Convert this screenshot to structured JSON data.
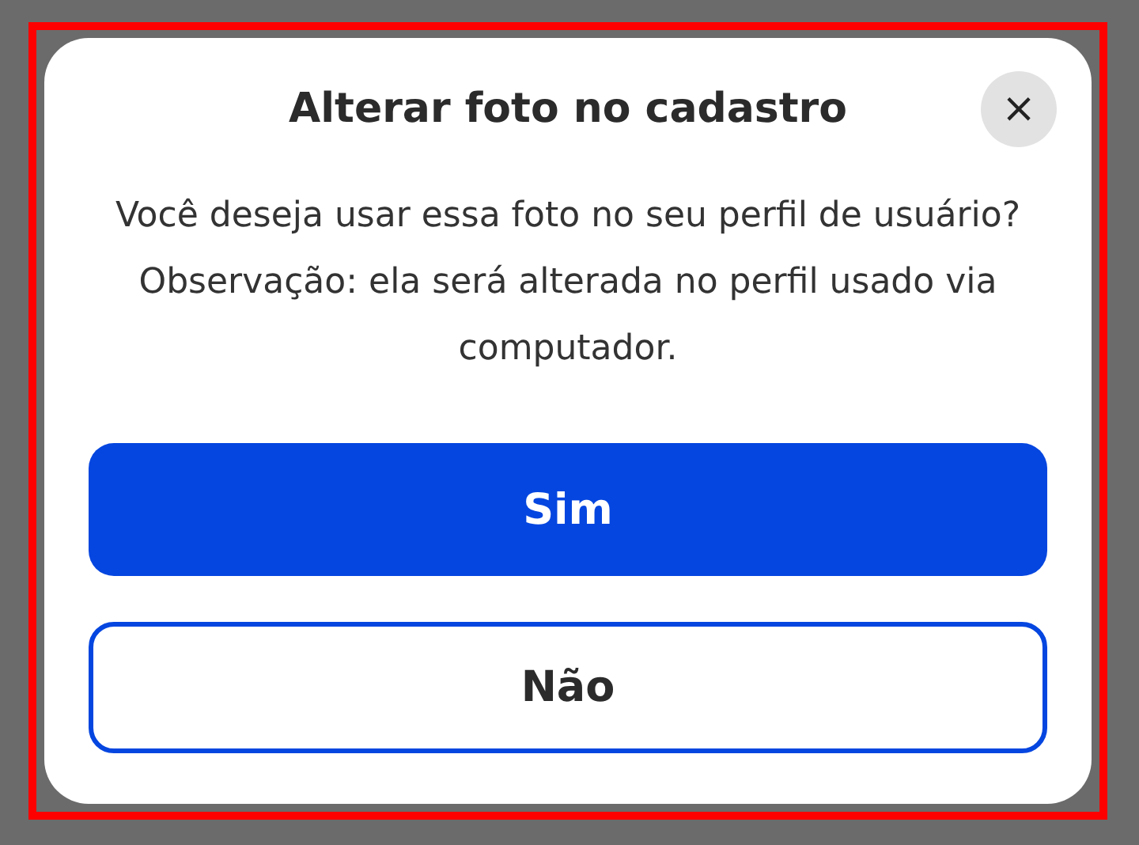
{
  "dialog": {
    "title": "Alterar foto no cadastro",
    "close": "×",
    "message": "Você deseja usar essa foto no seu perfil de usuário? Observação: ela será alterada no perfil usado via computador.",
    "buttons": [
      {
        "label": "Sim",
        "kind": "primary"
      },
      {
        "label": "Não",
        "kind": "secondary"
      }
    ]
  }
}
